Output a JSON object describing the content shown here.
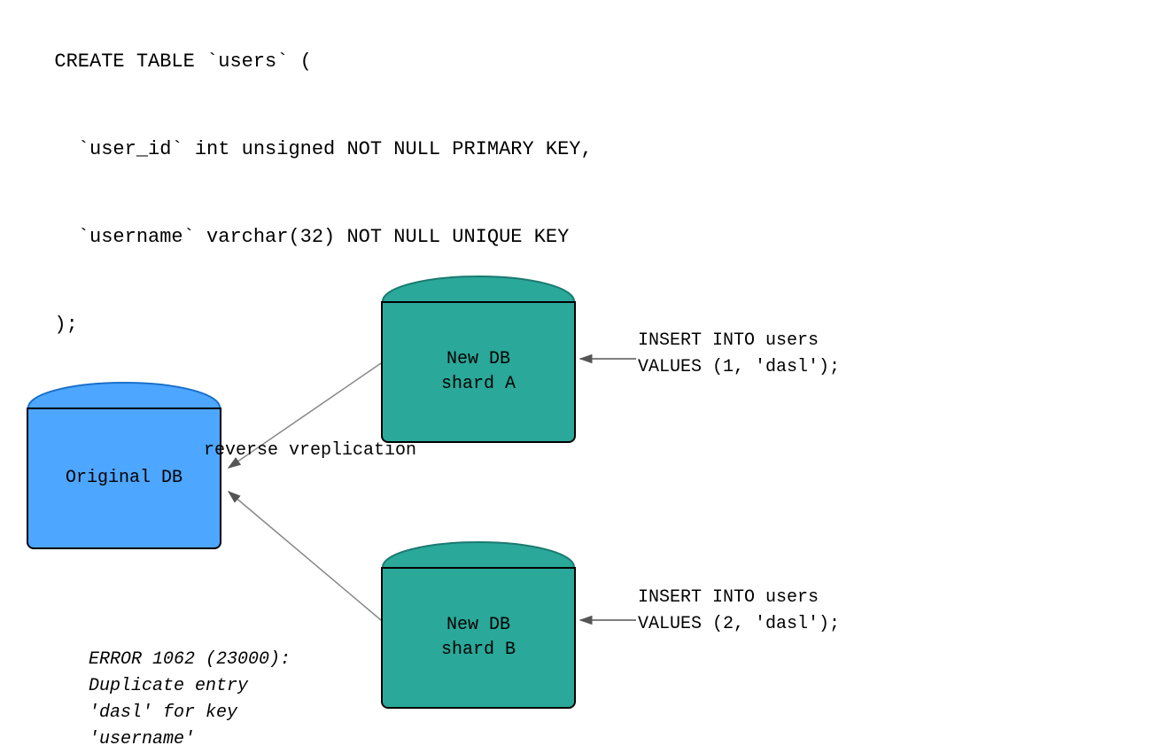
{
  "code": {
    "line1": "CREATE TABLE `users` (",
    "line2": "  `user_id` int unsigned NOT NULL PRIMARY KEY,",
    "line3": "  `username` varchar(32) NOT NULL UNIQUE KEY",
    "line4": ");"
  },
  "diagram": {
    "original_db_label": "Original DB",
    "shard_a_label": "New DB\nshard A",
    "shard_b_label": "New DB\nshard B",
    "reverse_label": "reverse\nvreplication",
    "insert_a_line1": "INSERT INTO users",
    "insert_a_line2": "VALUES (1, 'dasl');",
    "insert_b_line1": "INSERT INTO users",
    "insert_b_line2": "VALUES (2, 'dasl');",
    "error_line1": "ERROR 1062 (23000):",
    "error_line2": "Duplicate entry",
    "error_line3": "'dasl' for key",
    "error_line4": "'username'"
  },
  "colors": {
    "blue": "#4da6ff",
    "blue_border": "#2288ee",
    "green": "#2aa89a",
    "green_border": "#1a7a70",
    "black": "#000000"
  }
}
